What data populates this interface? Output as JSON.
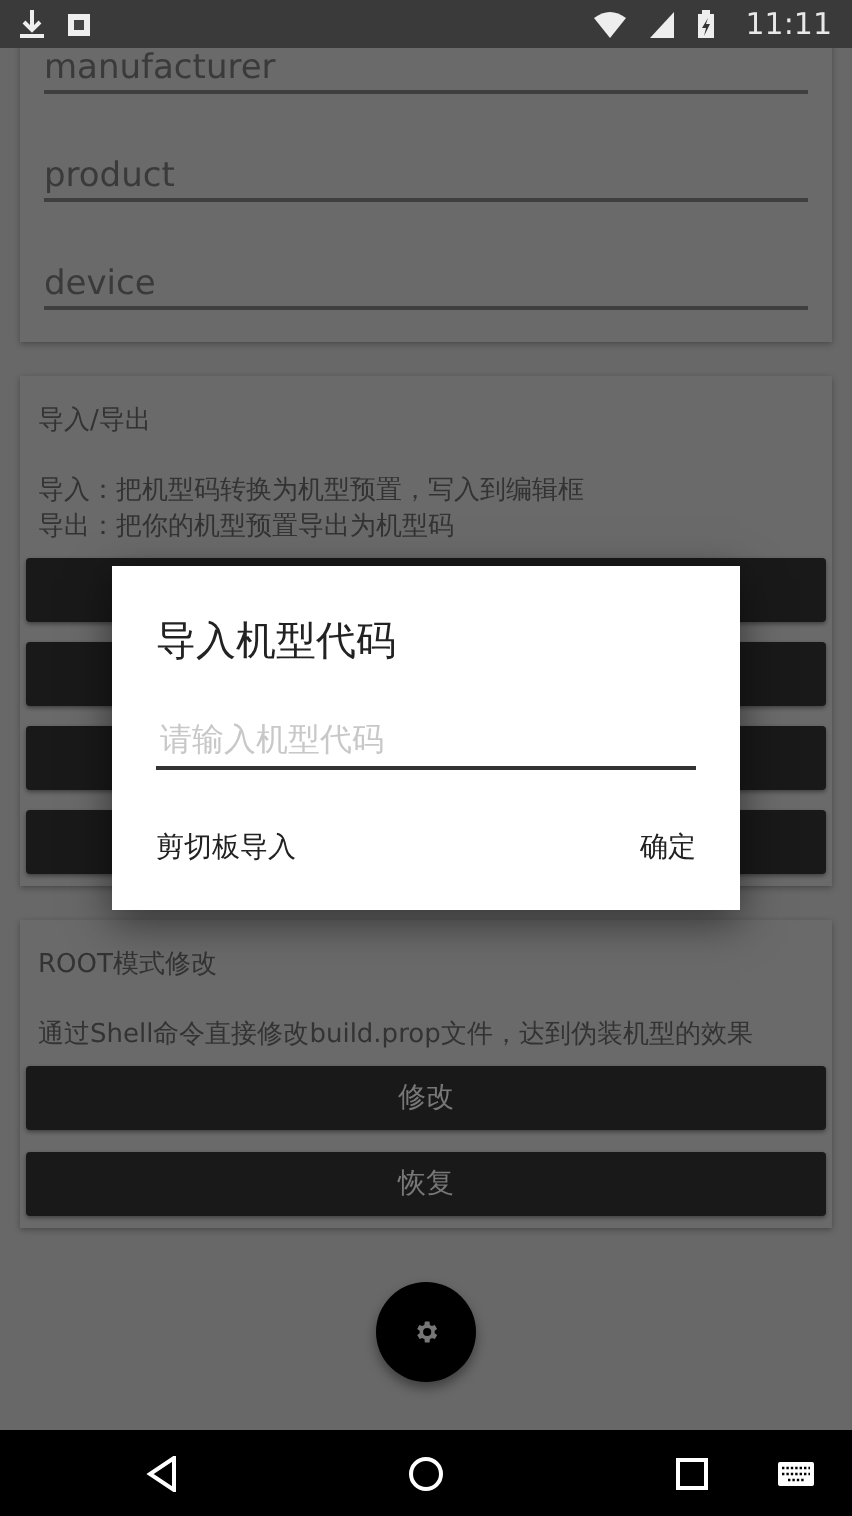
{
  "status_bar": {
    "time": "11:11"
  },
  "device_fields": [
    {
      "placeholder": "manufacturer"
    },
    {
      "placeholder": "product"
    },
    {
      "placeholder": "device"
    }
  ],
  "import_export": {
    "title": "导入/导出",
    "description_lines": [
      "导入：把机型码转换为机型预置，写入到编辑框",
      "导出：把你的机型预置导出为机型码"
    ]
  },
  "root_mode": {
    "title": "ROOT模式修改",
    "description": "通过Shell命令直接修改build.prop文件，达到伪装机型的效果",
    "buttons": [
      "修改",
      "恢复"
    ]
  },
  "dialog": {
    "title": "导入机型代码",
    "input": {
      "placeholder": "请输入机型代码"
    },
    "buttons": [
      "剪切板导入",
      "确定"
    ]
  }
}
